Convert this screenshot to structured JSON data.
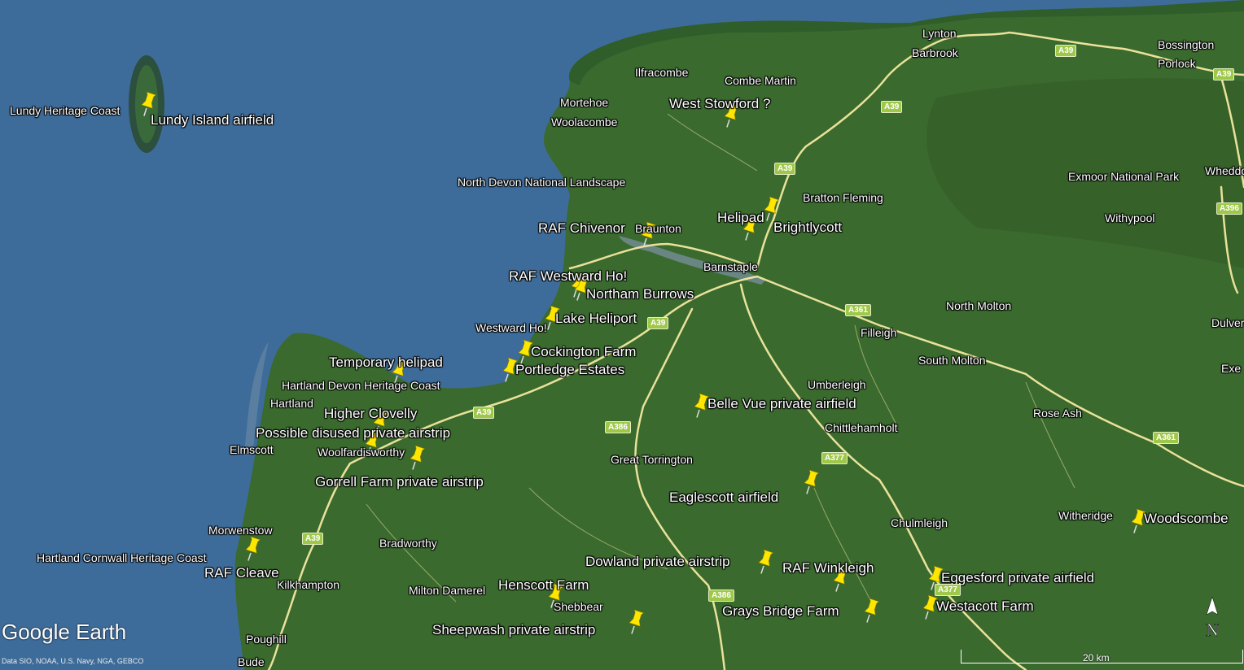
{
  "branding": {
    "logo": "Google Earth",
    "attribution": "Data SIO, NOAA, U.S. Navy, NGA, GEBCO"
  },
  "scale": {
    "label": "20 km"
  },
  "compass": {
    "label": "N"
  },
  "colors": {
    "sea": "#3e6c9a",
    "land": "#3a6a2e",
    "road": "#f3e9a0",
    "pin": "#ffe600",
    "shield": "#9fc84a"
  },
  "places": [
    "Lynton",
    "Barbrook",
    "Bossington",
    "Porlock",
    "Ilfracombe",
    "Combe Martin",
    "Mortehoe",
    "Woolacombe",
    "North Devon National Landscape",
    "Exmoor National Park",
    "Wheddon",
    "Bratton Fleming",
    "Withypool",
    "Braunton",
    "Barnstaple",
    "North Molton",
    "Dulver",
    "Westward Ho!",
    "Filleigh",
    "South Molton",
    "Exe",
    "Hartland Devon Heritage Coast",
    "Umberleigh",
    "Hartland",
    "Chittlehamholt",
    "Rose Ash",
    "Elmscott",
    "Woolfardisworthy",
    "Great Torrington",
    "Chulmleigh",
    "Witheridge",
    "Morwenstow",
    "Bradworthy",
    "Hartland Cornwall Heritage Coast",
    "Kilkhampton",
    "Milton Damerel",
    "Shebbear",
    "Poughill",
    "Bude",
    "Lundy Heritage Coast"
  ],
  "pois": [
    "Lundy Island airfield",
    "West Stowford ?",
    "Helipad",
    "Brightlycott",
    "RAF Chivenor",
    "RAF Westward Ho!",
    "Northam Burrows",
    "Lake Heliport",
    "Cockington Farm",
    "Portledge Estates",
    "Temporary helipad",
    "Belle Vue private airfield",
    "Higher Clovelly",
    "Possible disused private airstrip",
    "Gorrell Farm private airstrip",
    "Eaglescott airfield",
    "Woodscombe",
    "Dowland private airstrip",
    "RAF Winkleigh",
    "Eggesford private airfield",
    "RAF Cleave",
    "Henscott Farm",
    "Westacott Farm",
    "Grays Bridge Farm",
    "Sheepwash private airstrip"
  ],
  "roads": [
    "A39",
    "A39",
    "A39",
    "A39",
    "A39",
    "A39",
    "A39",
    "A396",
    "A361",
    "A361",
    "A386",
    "A386",
    "A377",
    "A377"
  ]
}
